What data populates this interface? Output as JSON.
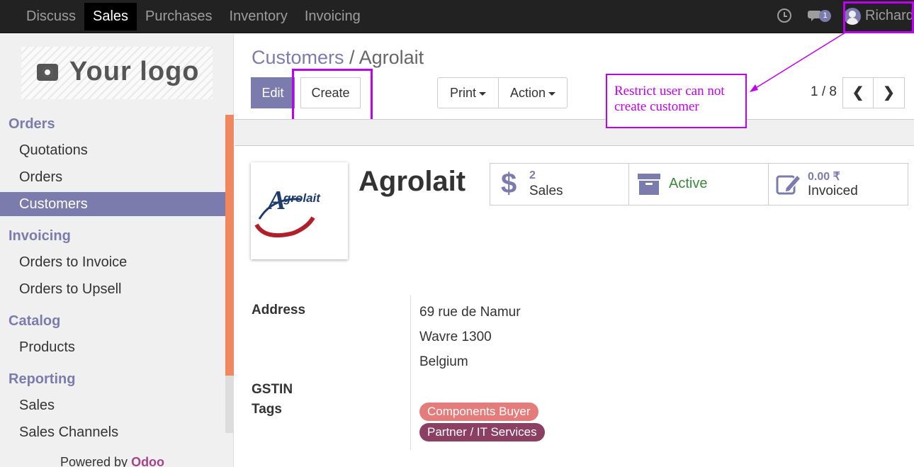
{
  "topbar": {
    "menu": [
      "Discuss",
      "Sales",
      "Purchases",
      "Inventory",
      "Invoicing"
    ],
    "active_index": 1,
    "chat_count": "1",
    "username": "Richard"
  },
  "sidebar": {
    "logo_text": "Your logo",
    "sections": [
      {
        "title": "Orders",
        "items": [
          "Quotations",
          "Orders",
          "Customers"
        ]
      },
      {
        "title": "Invoicing",
        "items": [
          "Orders to Invoice",
          "Orders to Upsell"
        ]
      },
      {
        "title": "Catalog",
        "items": [
          "Products"
        ]
      },
      {
        "title": "Reporting",
        "items": [
          "Sales",
          "Sales Channels"
        ]
      }
    ],
    "active_item": "Customers",
    "powered_prefix": "Powered by ",
    "powered_brand": "Odoo"
  },
  "breadcrumb": {
    "parent": "Customers",
    "separator": "/",
    "current": "Agrolait"
  },
  "buttons": {
    "edit": "Edit",
    "create": "Create",
    "print": "Print",
    "action": "Action"
  },
  "pager": {
    "text": "1 / 8"
  },
  "annotation": {
    "text": "Restrict user can not create customer",
    "color": "#c000f0"
  },
  "partner": {
    "name": "Agrolait",
    "logo_text": "grolait",
    "logo_letter": "A",
    "stats": {
      "sales_count": "2",
      "sales_label": "Sales",
      "active_label": "Active",
      "invoiced_amount": "0.00 ₹",
      "invoiced_label": "Invoiced"
    },
    "fields": {
      "address_label": "Address",
      "address_lines": [
        "69 rue de Namur",
        "Wavre 1300",
        "Belgium"
      ],
      "gstin_label": "GSTIN",
      "tags_label": "Tags",
      "tags": [
        "Components Buyer",
        "Partner / IT Services"
      ]
    }
  },
  "colors": {
    "brand": "#7c7bad",
    "highlight": "#c000f0",
    "scroll": "#f0875f",
    "active_status": "#3a8a3a"
  }
}
